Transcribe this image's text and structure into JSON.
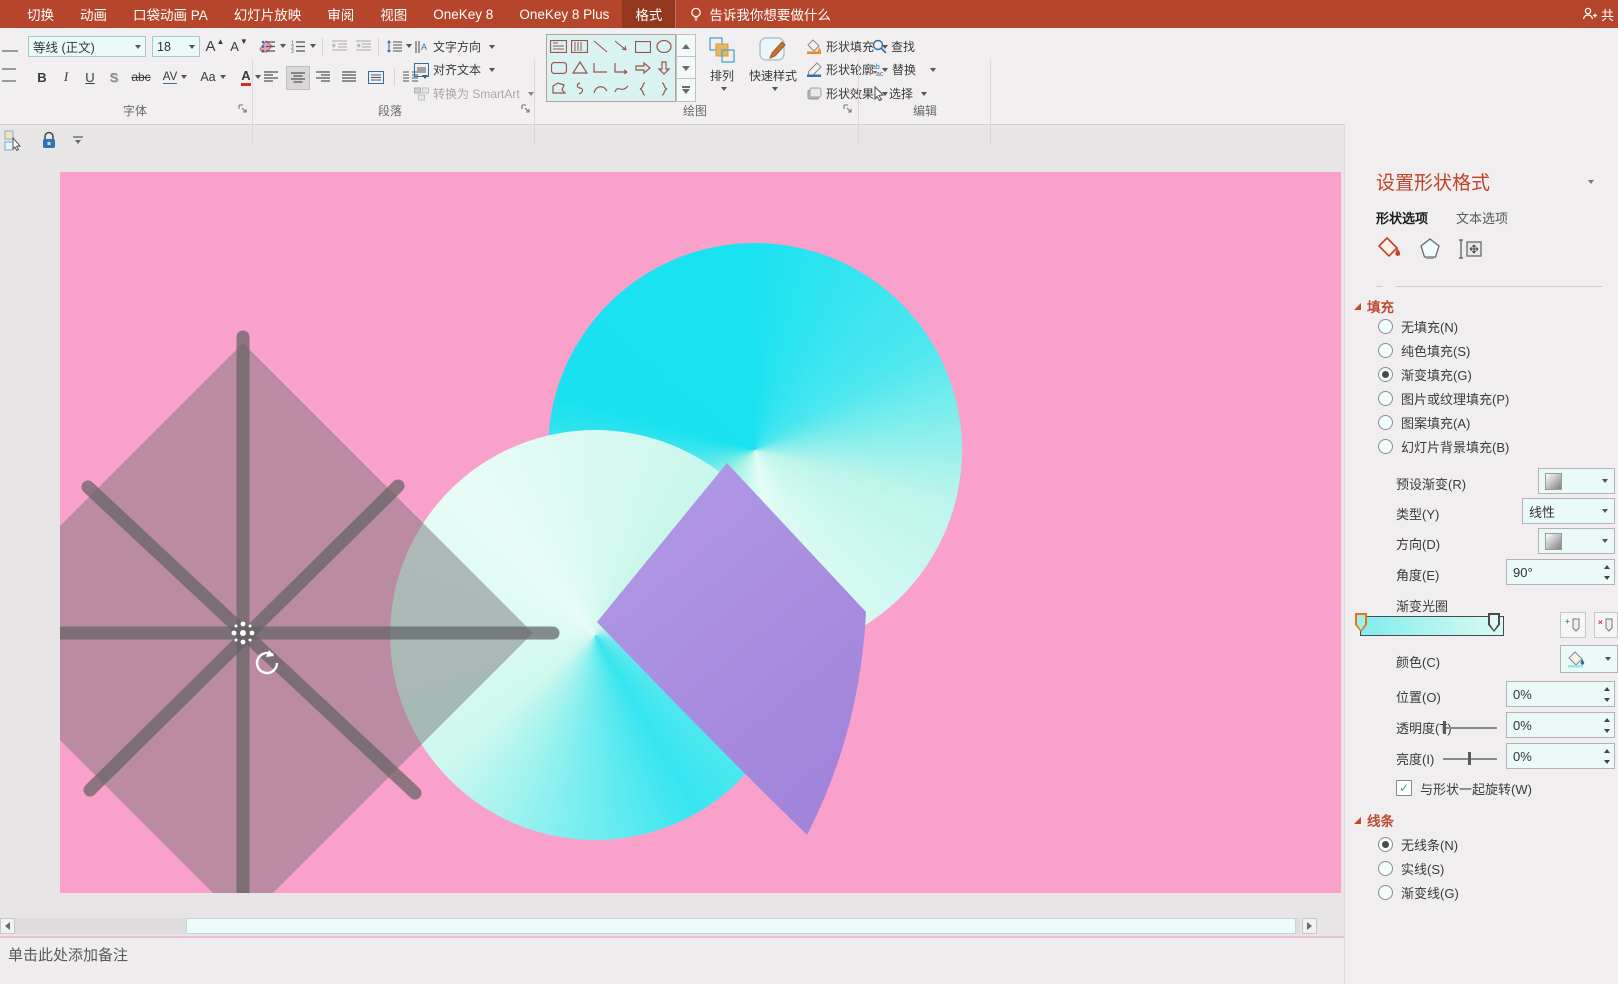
{
  "tabbar": {
    "tabs": [
      {
        "label": "切换",
        "active": false
      },
      {
        "label": "动画",
        "active": false
      },
      {
        "label": "口袋动画 PA",
        "active": false
      },
      {
        "label": "幻灯片放映",
        "active": false
      },
      {
        "label": "审阅",
        "active": false
      },
      {
        "label": "视图",
        "active": false
      },
      {
        "label": "OneKey 8",
        "active": false
      },
      {
        "label": "OneKey 8 Plus",
        "active": false
      },
      {
        "label": "格式",
        "active": true
      }
    ],
    "tellme": "告诉我你想要做什么",
    "share": "共"
  },
  "ribbon": {
    "font_group": {
      "label": "字体",
      "font_name": "等线 (正文)",
      "font_size": "18",
      "bold": "B",
      "italic": "I",
      "underline": "U",
      "shadow": "S",
      "strikethrough": "abc",
      "spacing": "AV",
      "case": "Aa",
      "color": "A"
    },
    "paragraph_group": {
      "label": "段落",
      "text_direction": "文字方向",
      "align_text": "对齐文本",
      "smartart": "转换为 SmartArt"
    },
    "drawing_group": {
      "label": "绘图",
      "arrange": "排列",
      "quick_styles": "快速样式",
      "shape_fill": "形状填充",
      "shape_outline": "形状轮廓",
      "shape_effects": "形状效果"
    },
    "edit_group": {
      "label": "编辑",
      "find": "查找",
      "replace": "替换",
      "select": "选择"
    }
  },
  "panel": {
    "title": "设置形状格式",
    "tabs": {
      "shape": "形状选项",
      "text": "文本选项"
    },
    "fill": {
      "header": "填充",
      "options": [
        {
          "label": "无填充(N)",
          "selected": false
        },
        {
          "label": "纯色填充(S)",
          "selected": false
        },
        {
          "label": "渐变填充(G)",
          "selected": true
        },
        {
          "label": "图片或纹理填充(P)",
          "selected": false
        },
        {
          "label": "图案填充(A)",
          "selected": false
        },
        {
          "label": "幻灯片背景填充(B)",
          "selected": false
        }
      ],
      "preset_label": "预设渐变(R)",
      "type_label": "类型(Y)",
      "type_value": "线性",
      "direction_label": "方向(D)",
      "angle_label": "角度(E)",
      "angle_value": "90°",
      "stops_label": "渐变光圈",
      "color_label": "颜色(C)",
      "position_label": "位置(O)",
      "position_value": "0%",
      "transparency_label": "透明度(T)",
      "transparency_value": "0%",
      "brightness_label": "亮度(I)",
      "brightness_value": "0%",
      "rotate_with_shape": "与形状一起旋转(W)",
      "rotate_checked": true
    },
    "line": {
      "header": "线条",
      "options": [
        {
          "label": "无线条(N)",
          "selected": true
        },
        {
          "label": "实线(S)",
          "selected": false
        },
        {
          "label": "渐变线(G)",
          "selected": false
        }
      ]
    }
  },
  "notes": {
    "placeholder": "单击此处添加备注"
  },
  "colors": {
    "ribbon_red": "#B5452B",
    "active_tab": "#93381E",
    "slide_pink": "#F9A1CB",
    "cyan": "#1BE2F1",
    "mint": "#DFFBF3",
    "purple": "#A78BE0",
    "panel_header_red": "#BE4B32"
  }
}
